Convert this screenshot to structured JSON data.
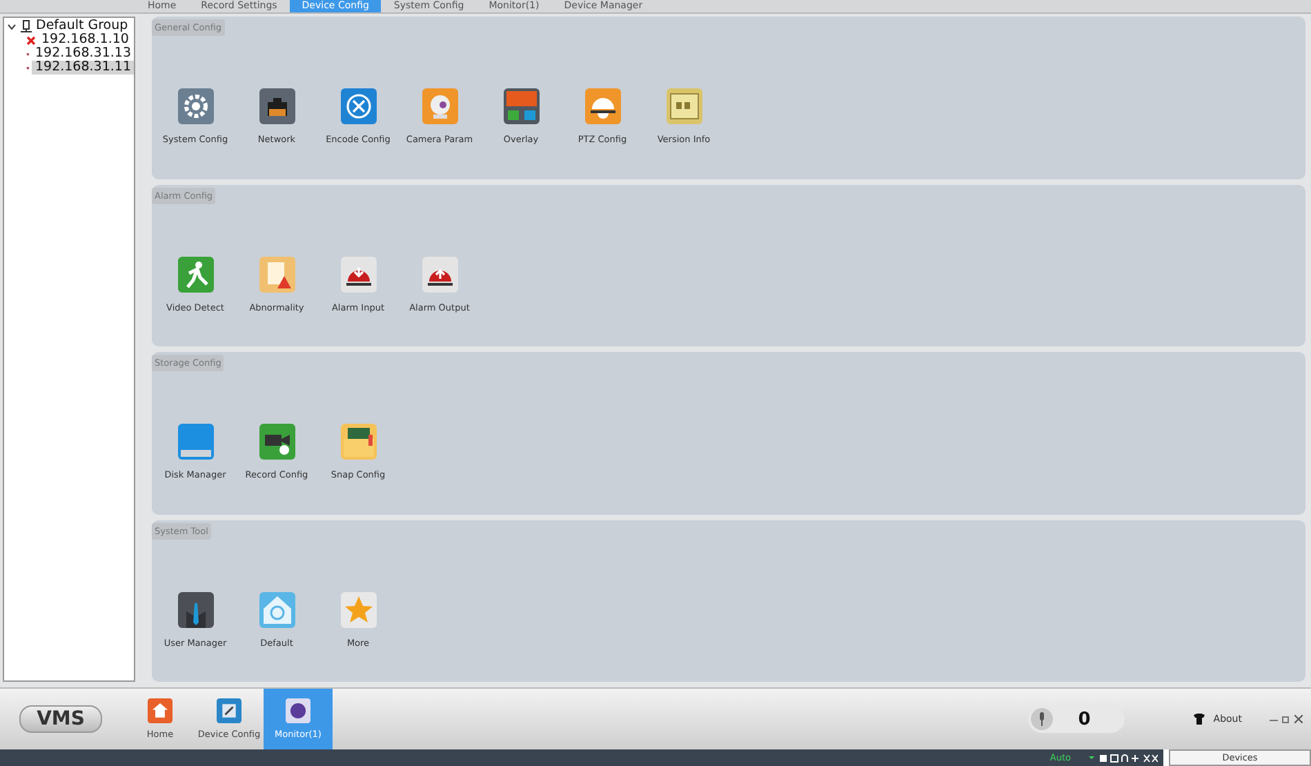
{
  "top_tabs": [
    {
      "label": "Home",
      "selected": false
    },
    {
      "label": "Record Settings",
      "selected": false
    },
    {
      "label": "Device Config",
      "selected": true
    },
    {
      "label": "System Config",
      "selected": false
    },
    {
      "label": "Monitor(1)",
      "selected": false
    },
    {
      "label": "Device Manager",
      "selected": false
    }
  ],
  "tree": {
    "label": "Default Group",
    "expanded": true,
    "children": [
      {
        "label": "192.168.1.10",
        "kind": "offline",
        "selected": false
      },
      {
        "label": "192.168.31.13",
        "kind": "online",
        "selected": false
      },
      {
        "label": "192.168.31.11",
        "kind": "online",
        "selected": true
      }
    ]
  },
  "sections": [
    {
      "title": "General Config",
      "items": [
        "System Config",
        "Network",
        "Encode Config",
        "Camera Param",
        "Overlay",
        "PTZ Config",
        "Version Info"
      ]
    },
    {
      "title": "Alarm Config",
      "items": [
        "Video Detect",
        "Abnormality",
        "Alarm Input",
        "Alarm Output"
      ]
    },
    {
      "title": "Storage Config",
      "items": [
        "Disk Manager",
        "Record Config",
        "Snap Config"
      ]
    },
    {
      "title": "System Tool",
      "items": [
        "User Manager",
        "Default",
        "More"
      ]
    }
  ],
  "logo": "VMS",
  "bottom_tabs": [
    {
      "label": "Home",
      "selected": false
    },
    {
      "label": "Device Config",
      "selected": false
    },
    {
      "label": "Monitor(1)",
      "selected": true
    }
  ],
  "counter": "0",
  "about": "About",
  "status_bar": {
    "mode": "Auto",
    "tab": "Devices"
  }
}
